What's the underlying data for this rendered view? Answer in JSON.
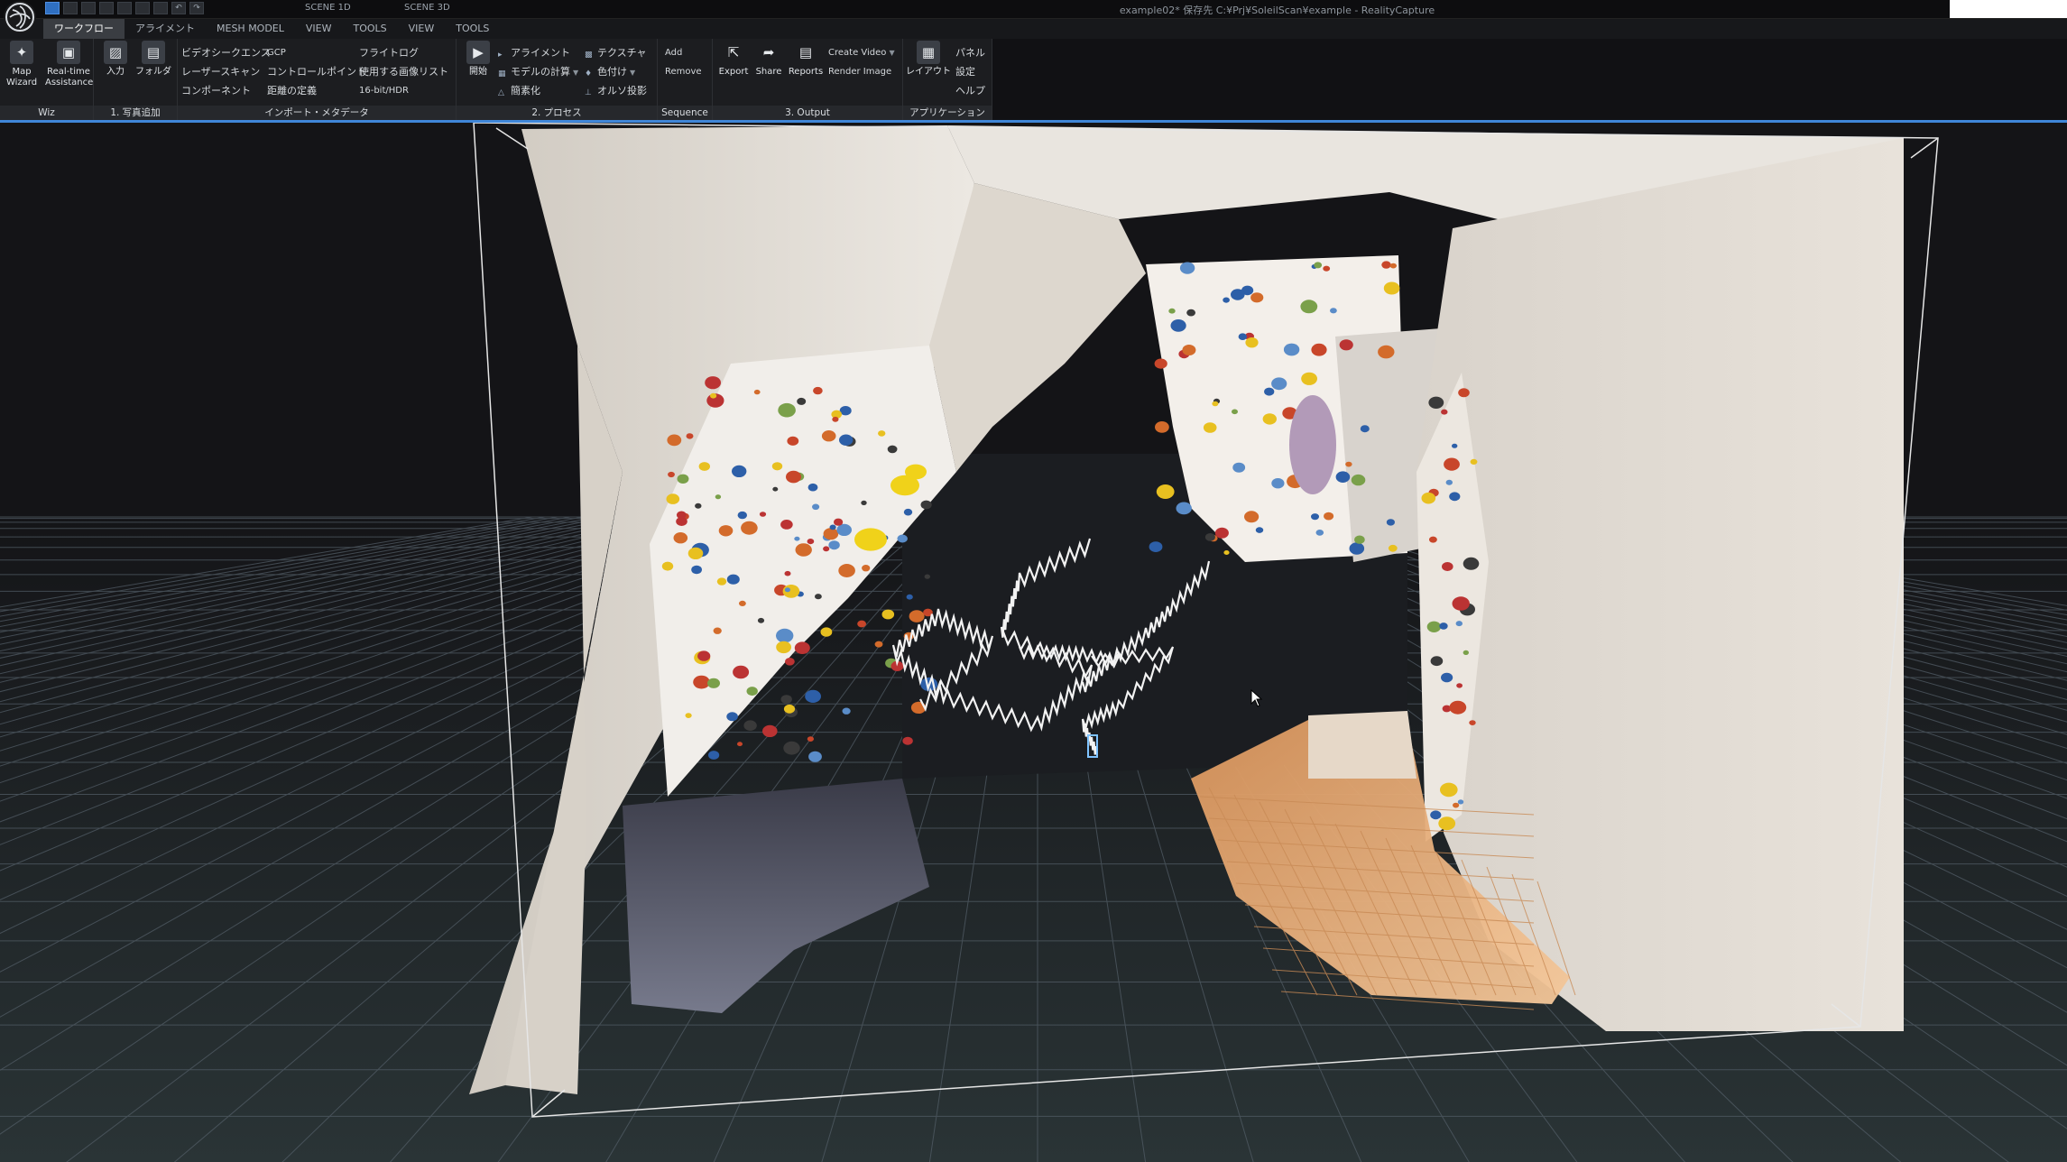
{
  "titlebar": {
    "scene_1d": "SCENE 1D",
    "scene_3d": "SCENE 3D",
    "app_title": "example02* 保存先 C:¥Prj¥SoleilScan¥example - RealityCapture",
    "qat_icons": [
      "layout-icon",
      "layout-icon",
      "layout-icon",
      "layout-icon",
      "layout-icon",
      "layout-icon",
      "layout-icon",
      "undo-icon",
      "redo-icon"
    ]
  },
  "menu": {
    "tabs": [
      "ワークフロー",
      "アライメント",
      "MESH MODEL",
      "VIEW",
      "TOOLS",
      "VIEW",
      "TOOLS"
    ],
    "active": "ワークフロー"
  },
  "ribbon": {
    "wiz": {
      "footer": "Wiz",
      "map_wizard": "Map\nWizard",
      "realtime": "Real-time\nAssistance"
    },
    "add_photos": {
      "footer": "1. 写真追加",
      "input": "入力",
      "folder": "フォルダ"
    },
    "import": {
      "footer": "インポート・メタデータ",
      "video_sequence": "ビデオシークエンス",
      "laser_scan": "レーザースキャン",
      "component": "コンポーネント",
      "gcp": "GCP",
      "control_point": "コントロールポイント",
      "distance": "距離の定義",
      "flight_log": "フライトログ",
      "image_list": "使用する画像リスト",
      "bit_hdr": "16-bit/HDR"
    },
    "process": {
      "footer": "2. プロセス",
      "start": "開始",
      "alignment": "アライメント",
      "compute_model": "モデルの計算",
      "simplify": "簡素化",
      "texture": "テクスチャ",
      "colorize": "色付け",
      "ortho": "オルソ投影"
    },
    "sequence": {
      "footer": "Sequence",
      "add": "Add",
      "remove": "Remove"
    },
    "output": {
      "footer": "3. Output",
      "export": "Export",
      "share": "Share",
      "reports": "Reports",
      "create_video": "Create Video",
      "render_image": "Render Image"
    },
    "application": {
      "footer": "アプリケーション",
      "layout": "レイアウト",
      "panel": "パネル",
      "settings": "設定",
      "help": "ヘルプ"
    }
  },
  "colors": {
    "accent": "#3f86d8",
    "ribbon_bg": "#1c1d20",
    "viewport_bg": "#141417",
    "wall": "#e6e1da"
  }
}
